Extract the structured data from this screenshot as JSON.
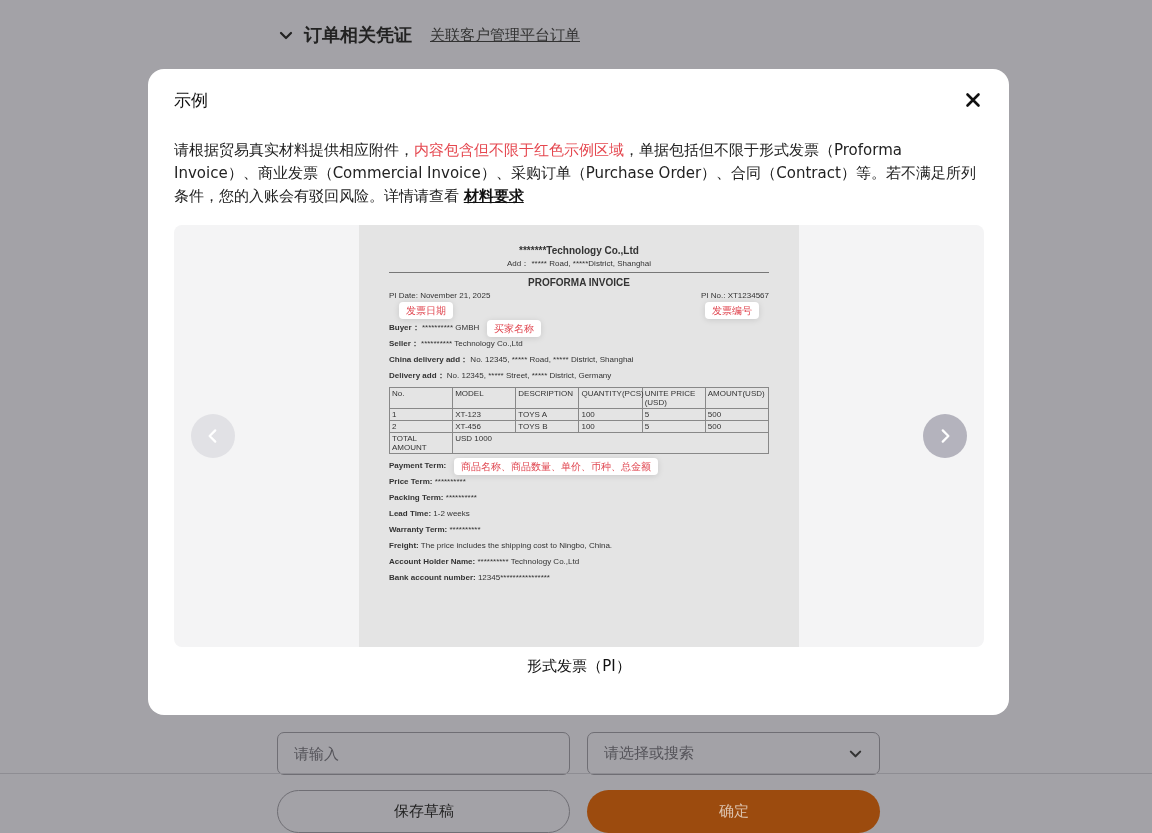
{
  "page": {
    "section": {
      "expanded": true,
      "title": "订单相关凭证",
      "link": "关联客户管理平台订单"
    },
    "fields": [
      {
        "kind": "input",
        "placeholder": "请输入"
      },
      {
        "kind": "select",
        "placeholder": "请选择或搜索"
      }
    ],
    "buttons": [
      {
        "kind": "secondary",
        "label": "保存草稿"
      },
      {
        "kind": "primary",
        "label": "确定"
      }
    ]
  },
  "dialog": {
    "title": "示例",
    "description": [
      {
        "kind": "text",
        "text": "请根据贸易真实材料提供相应附件，"
      },
      {
        "kind": "highlight",
        "text": "内容包含但不限于红色示例区域"
      },
      {
        "kind": "text",
        "text": "，单据包括但不限于形式发票（Proforma Invoice）、商业发票（Commercial Invoice）、采购订单（Purchase Order）、合同（Contract）等。若不满足所列条件，您的入账会有驳回风险。详情请查看 "
      },
      {
        "kind": "link",
        "text": "材料要求"
      }
    ],
    "carousel": {
      "prev": {
        "disabled": true
      },
      "next": {
        "disabled": false
      },
      "caption": "形式发票（PI）",
      "document": {
        "company": "*******Technology Co.,Ltd",
        "address": "Add：  ***** Road, *****District, Shanghai",
        "title": "PROFORMA INVOICE",
        "date": "PI Date: November 21, 2025",
        "number": "PI No.: XT1234567",
        "parties": [
          {
            "label": "Buyer：",
            "value": "********** GMBH"
          },
          {
            "label": "Seller：",
            "value": "********** Technology Co.,Ltd"
          },
          {
            "label": "China delivery add：",
            "value": "No. 12345, ***** Road, ***** District, Shanghai"
          },
          {
            "label": "Delivery add：",
            "value": "No. 12345, ***** Street, ***** District, Germany"
          }
        ],
        "table": {
          "columns": [
            "No.",
            "MODEL",
            "DESCRIPTION",
            "QUANTITY(PCS)",
            "UNITE PRICE (USD)",
            "AMOUNT(USD)"
          ],
          "rows": [
            [
              "1",
              "XT-123",
              "TOYS A",
              "100",
              "5",
              "500"
            ],
            [
              "2",
              "XT-456",
              "TOYS B",
              "100",
              "5",
              "500"
            ]
          ],
          "total": {
            "label": "TOTAL AMOUNT",
            "value": "USD 1000"
          }
        },
        "terms": [
          {
            "label": "Payment Term:"
          },
          {
            "label": "Price Term:",
            "value": "**********"
          },
          {
            "label": "Packing Term:",
            "value": "**********"
          },
          {
            "label": "Lead Time:",
            "value": "1-2 weeks"
          },
          {
            "label": "Warranty Term:",
            "value": "**********"
          },
          {
            "label": "Freight:",
            "value": "The price includes the shipping cost to Ningbo, China."
          },
          {
            "label": "Account Holder Name:",
            "value": "********** Technology Co.,Ltd"
          },
          {
            "label": "Bank account number:",
            "value": "12345****************"
          }
        ],
        "callouts": [
          {
            "kind": "date",
            "text": "发票日期"
          },
          {
            "kind": "number",
            "text": "发票编号"
          },
          {
            "kind": "buyer",
            "text": "买家名称"
          },
          {
            "kind": "goods",
            "text": "商品名称、商品数量、单价、币种、总金额"
          }
        ]
      }
    }
  }
}
